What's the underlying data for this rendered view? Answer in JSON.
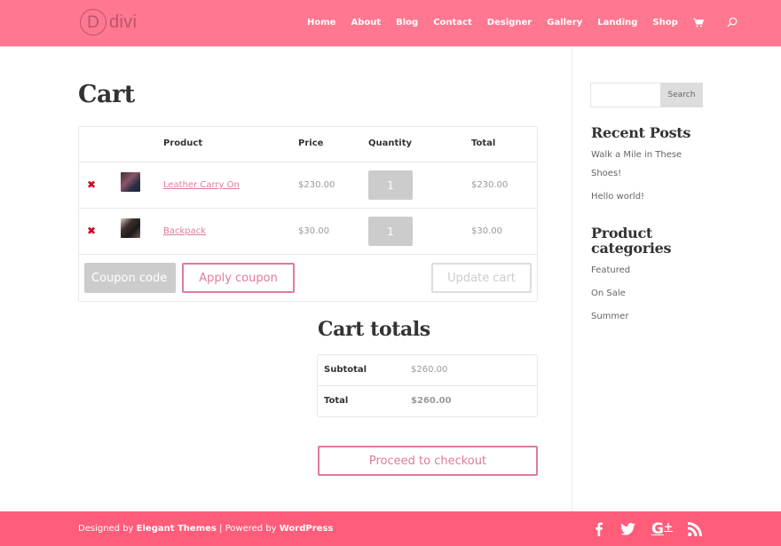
{
  "header": {
    "logo_letter": "D",
    "logo_text": "divi",
    "nav": [
      {
        "label": "Home"
      },
      {
        "label": "About"
      },
      {
        "label": "Blog"
      },
      {
        "label": "Contact"
      },
      {
        "label": "Designer"
      },
      {
        "label": "Gallery"
      },
      {
        "label": "Landing"
      },
      {
        "label": "Shop"
      }
    ],
    "icons": {
      "cart": "shopping-cart-icon",
      "search": "search-icon"
    }
  },
  "page": {
    "title": "Cart"
  },
  "cart": {
    "columns": {
      "product": "Product",
      "price": "Price",
      "quantity": "Quantity",
      "total": "Total"
    },
    "items": [
      {
        "name": "Leather Carry On",
        "price": "$230.00",
        "quantity": "1",
        "total": "$230.00",
        "remove": "✖"
      },
      {
        "name": "Backpack",
        "price": "$30.00",
        "quantity": "1",
        "total": "$30.00",
        "remove": "✖"
      }
    ],
    "coupon_placeholder": "Coupon code",
    "apply_coupon": "Apply coupon",
    "update_cart": "Update cart"
  },
  "totals": {
    "title": "Cart totals",
    "subtotal_label": "Subtotal",
    "subtotal_value": "$260.00",
    "total_label": "Total",
    "total_value": "$260.00",
    "checkout": "Proceed to checkout"
  },
  "sidebar": {
    "search_button": "Search",
    "recent_posts_title": "Recent Posts",
    "recent_posts": [
      {
        "line1": "Walk a Mile in These",
        "line2": "Shoes!"
      },
      {
        "line1": "Hello world!"
      }
    ],
    "categories_title_line1": "Product",
    "categories_title_line2": "categories",
    "categories": [
      "Featured",
      "On Sale",
      "Summer"
    ]
  },
  "footer": {
    "designed_by": "Designed by ",
    "elegant": "Elegant Themes",
    "separator": " | Powered by ",
    "wordpress": "WordPress",
    "social": [
      "facebook-icon",
      "twitter-icon",
      "google-plus-icon",
      "rss-icon"
    ]
  },
  "colors": {
    "header_bg": "#ff7790",
    "footer_bg": "#ff5d7a",
    "accent": "#e07b98",
    "remove": "#d0021b"
  }
}
